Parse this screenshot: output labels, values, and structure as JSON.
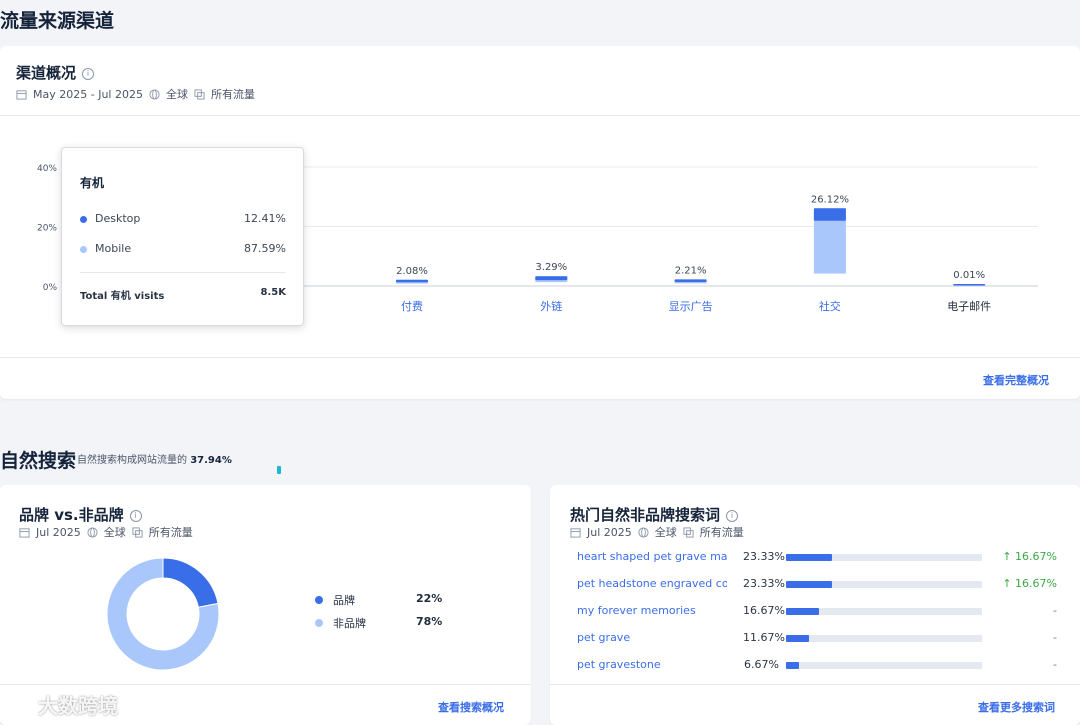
{
  "page_title": "流量来源渠道",
  "overview": {
    "title": "渠道概况",
    "date_range": "May 2025 - Jul 2025",
    "region": "全球",
    "traffic": "所有流量",
    "view_full_link": "查看完整概况"
  },
  "tooltip": {
    "title": "有机",
    "rows": [
      {
        "label": "Desktop",
        "value": "12.41%"
      },
      {
        "label": "Mobile",
        "value": "87.59%"
      }
    ],
    "total_label": "Total 有机 visits",
    "total_value": "8.5K"
  },
  "chart_data": {
    "type": "bar",
    "y_ticks": [
      "40%",
      "20%",
      "0%"
    ],
    "ylim": [
      0,
      40
    ],
    "categories": [
      "付费",
      "外链",
      "显示广告",
      "社交",
      "电子邮件"
    ],
    "values": [
      2.08,
      3.29,
      2.21,
      26.12,
      0.01
    ],
    "value_labels": [
      "2.08%",
      "3.29%",
      "2.21%",
      "26.12%",
      "0.01%"
    ],
    "desktop_share": [
      0.4,
      0.4,
      0.4,
      0.16,
      0.3
    ],
    "series": [
      {
        "name": "Desktop",
        "color": "#3a6ee8"
      },
      {
        "name": "Mobile",
        "color": "#a9c7fb"
      }
    ]
  },
  "organic": {
    "title": "自然搜索",
    "subtitle": "自然搜索构成网站流量的",
    "subtitle_value": "37.94%"
  },
  "brand": {
    "title": "品牌 vs.非品牌",
    "date": "Jul 2025",
    "region": "全球",
    "traffic": "所有流量",
    "legend": [
      {
        "label": "品牌",
        "value": "22%",
        "share": 0.22,
        "color": "#3a6ee8"
      },
      {
        "label": "非品牌",
        "value": "78%",
        "share": 0.78,
        "color": "#a9c7fb"
      }
    ],
    "link": "查看搜索概况"
  },
  "keywords": {
    "title": "热门自然非品牌搜索词",
    "date": "Jul 2025",
    "region": "全球",
    "traffic": "所有流量",
    "rows": [
      {
        "term": "heart shaped pet grave mar...",
        "share": "23.33%",
        "fill": 0.2333,
        "change": "↑ 16.67%"
      },
      {
        "term": "pet headstone engraved co...",
        "share": "23.33%",
        "fill": 0.2333,
        "change": "↑ 16.67%"
      },
      {
        "term": "my forever memories",
        "share": "16.67%",
        "fill": 0.1667,
        "change": "-"
      },
      {
        "term": "pet grave",
        "share": "11.67%",
        "fill": 0.1167,
        "change": "-"
      },
      {
        "term": "pet gravestone",
        "share": "6.67%",
        "fill": 0.0667,
        "change": "-"
      }
    ],
    "link": "查看更多搜索词"
  },
  "watermark": "大数跨境"
}
